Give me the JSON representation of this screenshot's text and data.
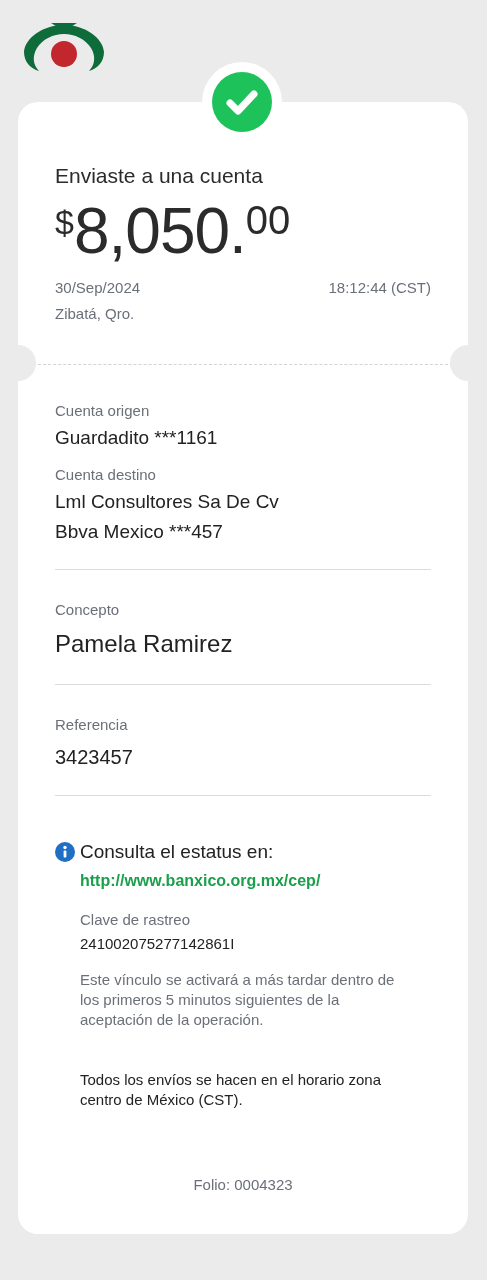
{
  "title": "Enviaste a una cuenta",
  "amount": {
    "currency": "$",
    "whole": "8,050",
    "decimal_point": ".",
    "cents": "00"
  },
  "date": "30/Sep/2024",
  "time": "18:12:44 (CST)",
  "location": "Zibatá, Qro.",
  "sections": [
    {
      "fields": [
        {
          "kind": "account",
          "label": "Cuenta origen",
          "lines": [
            "Guardadito ***1161"
          ]
        },
        {
          "kind": "account",
          "label": "Cuenta destino",
          "lines": [
            "Lml Consultores Sa De Cv",
            "Bbva Mexico ***457"
          ]
        }
      ]
    },
    {
      "fields": [
        {
          "kind": "concept",
          "label": "Concepto",
          "lines": [
            "Pamela Ramirez"
          ]
        }
      ]
    },
    {
      "fields": [
        {
          "kind": "reference",
          "label": "Referencia",
          "lines": [
            "3423457"
          ]
        }
      ]
    }
  ],
  "info": {
    "heading": "Consulta el estatus en:",
    "link": "http://www.banxico.org.mx/cep/",
    "tracking_label": "Clave de rastreo",
    "tracking_key": "241002075277142861I",
    "note": "Este vínculo se activará a más tardar dentro de los primeros 5 minutos siguientes de la aceptación de la operación."
  },
  "disclaimer": "Todos los envíos se hacen en el horario zona centro de México (CST).",
  "folio": "Folio: 0004323"
}
